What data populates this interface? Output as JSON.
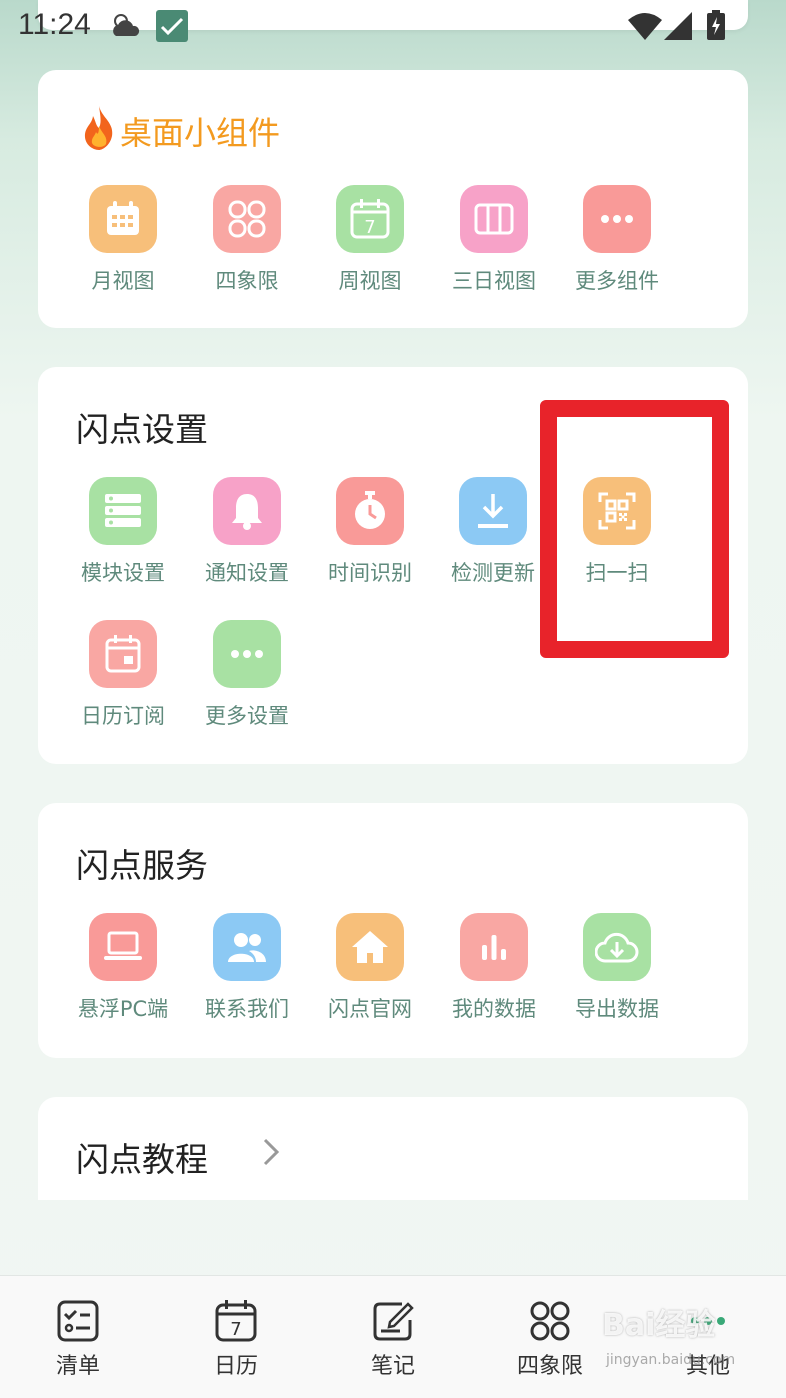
{
  "status_bar": {
    "time": "11:24"
  },
  "widgets": {
    "title": "桌面小组件",
    "items": [
      {
        "label": "月视图",
        "icon": "month-calendar-icon",
        "color": "#f7bf7a"
      },
      {
        "label": "四象限",
        "icon": "four-quadrant-icon",
        "color": "#f9a7a3"
      },
      {
        "label": "周视图",
        "icon": "week-calendar-icon",
        "color": "#a8e1a3"
      },
      {
        "label": "三日视图",
        "icon": "three-day-view-icon",
        "color": "#f7a2c8"
      },
      {
        "label": "更多组件",
        "icon": "more-icon",
        "color": "#f99a98"
      }
    ]
  },
  "settings": {
    "title": "闪点设置",
    "items": [
      {
        "label": "模块设置",
        "icon": "module-list-icon",
        "color": "#a8e1a3"
      },
      {
        "label": "通知设置",
        "icon": "bell-icon",
        "color": "#f7a2c8"
      },
      {
        "label": "时间识别",
        "icon": "stopwatch-icon",
        "color": "#f99a98"
      },
      {
        "label": "检测更新",
        "icon": "download-icon",
        "color": "#8cc9f4"
      },
      {
        "label": "扫一扫",
        "icon": "qr-scan-icon",
        "color": "#f7bf7a"
      },
      {
        "label": "日历订阅",
        "icon": "calendar-subscribe-icon",
        "color": "#f9a7a3"
      },
      {
        "label": "更多设置",
        "icon": "more-icon",
        "color": "#a8e1a3"
      }
    ]
  },
  "services": {
    "title": "闪点服务",
    "items": [
      {
        "label": "悬浮PC端",
        "icon": "laptop-icon",
        "color": "#f99a98"
      },
      {
        "label": "联系我们",
        "icon": "people-icon",
        "color": "#8cc9f4"
      },
      {
        "label": "闪点官网",
        "icon": "home-icon",
        "color": "#f7bf7a"
      },
      {
        "label": "我的数据",
        "icon": "bar-chart-icon",
        "color": "#f9a7a3"
      },
      {
        "label": "导出数据",
        "icon": "cloud-download-icon",
        "color": "#a8e1a3"
      }
    ]
  },
  "tutorial": {
    "title": "闪点教程"
  },
  "bottom_nav": {
    "items": [
      {
        "label": "清单",
        "icon": "checklist-icon"
      },
      {
        "label": "日历",
        "icon": "calendar-icon"
      },
      {
        "label": "笔记",
        "icon": "note-edit-icon"
      },
      {
        "label": "四象限",
        "icon": "four-quadrant-icon"
      },
      {
        "label": "其他",
        "icon": "more-icon"
      }
    ]
  },
  "watermark": {
    "text": "Bai经验",
    "sub": "jingyan.baidu.com"
  },
  "colors": {
    "highlight": "#e8232a",
    "accent_orange": "#f39a1f",
    "label_green": "#5f8a7c"
  }
}
